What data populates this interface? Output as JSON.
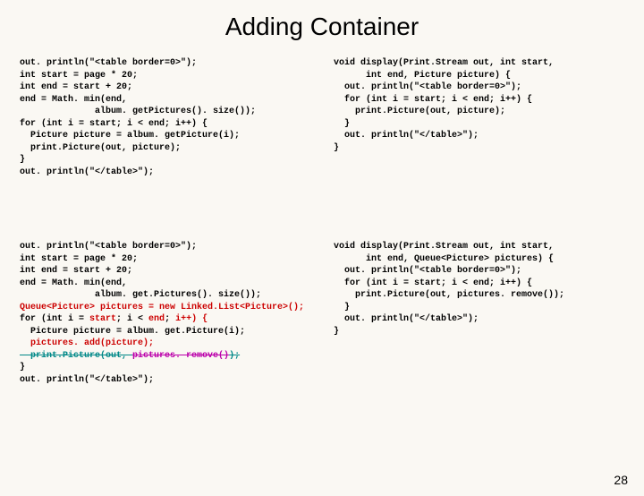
{
  "title": "Adding Container",
  "page_number": "28",
  "code": {
    "top_left": "out. println(\"<table border=0>\");\nint start = page * 20;\nint end = start + 20;\nend = Math. min(end,\n              album. getPictures(). size());\nfor (int i = start; i < end; i++) {\n  Picture picture = album. getPicture(i);\n  print.Picture(out, picture);\n}\nout. println(\"</table>\");",
    "top_right": "void display(Print.Stream out, int start,\n      int end, Picture picture) {\n  out. println(\"<table border=0>\");\n  for (int i = start; i < end; i++) {\n    print.Picture(out, picture);\n  }\n  out. println(\"</table>\");\n}",
    "bottom_left_pre": "out. println(\"<table border=0>\");\nint start = page * 20;\nint end = start + 20;\nend = Math. min(end,\n              album. get.Pictures(). size());\n",
    "bottom_left_queue": "Queue<Picture> pictures = new Linked.List<Picture>();",
    "bottom_left_for_a": "for (int i = ",
    "bottom_left_for_start": "start",
    "bottom_left_for_b": "; i < ",
    "bottom_left_for_end": "end",
    "bottom_left_for_c": "; ",
    "bottom_left_for_ipp": "i++) {",
    "bottom_left_pict_line": "  Picture picture = album. get.Picture(i);",
    "bottom_left_add_a": "  pictures. add(",
    "bottom_left_add_p": "picture",
    "bottom_left_add_b": ");",
    "bottom_left_strike1": "  print.Picture(out, ",
    "bottom_left_strike2": "pictures. remove()",
    "bottom_left_strike3": ");",
    "bottom_left_post": "}\nout. println(\"</table>\");",
    "bottom_right": "void display(Print.Stream out, int start,\n      int end, Queue<Picture> pictures) {\n  out. println(\"<table border=0>\");\n  for (int i = start; i < end; i++) {\n    print.Picture(out, pictures. remove());\n  }\n  out. println(\"</table>\");\n}"
  }
}
